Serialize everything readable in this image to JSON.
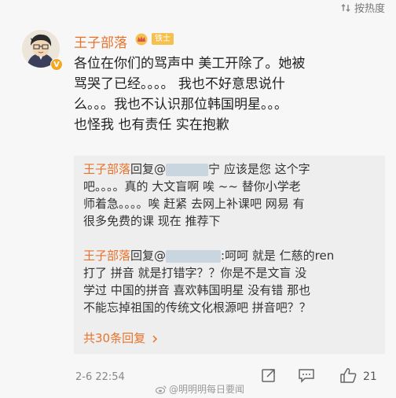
{
  "topbar": {
    "sort_label": "按热度"
  },
  "post": {
    "author": "王子部落",
    "author_badge": "铁士",
    "verified_mark": "V",
    "content_lines": [
      "各位在你们的骂声中 美工开除了。她被",
      "骂哭了已经。。。。 我也不好意思说什",
      "么。。。我也不认识那位韩国明星。。。",
      "也怪我 也有责任 实在抱歉"
    ]
  },
  "replies": [
    {
      "author": "王子部落",
      "reply_word": "回复@",
      "target_tail": "宁",
      "lines": [
        " 应该是您 这个字",
        "吧。。。。真的 大文盲啊 唉 ~~ 替你小学老",
        "师着急。。。。唉 赶紧 去网上补课吧 网易 有",
        "很多免费的课 现在 推荐下"
      ]
    },
    {
      "author": "王子部落",
      "reply_word": "回复@",
      "lines": [
        ":呵呵 就是 仁慈的ren",
        "打了 拼音 就是打错字？？你是不是文盲 没",
        "学过 中国的拼音  喜欢韩国明星 没有错 那也",
        "不能忘掉祖国的传统文化根源吧 拼音吧？？"
      ]
    }
  ],
  "more_replies": "共30条回复",
  "meta": {
    "time": "2-6 22:54",
    "like_count": "21"
  },
  "watermark": "@明明明每日要闻",
  "colors": {
    "accent": "#e8722b",
    "background": "#f7f7f7",
    "reply_bg": "#eeeeee"
  },
  "icons": [
    "sort-icon",
    "crown-icon",
    "share-icon",
    "comment-icon",
    "like-icon",
    "weibo-logo-icon",
    "chevron-right-icon"
  ]
}
